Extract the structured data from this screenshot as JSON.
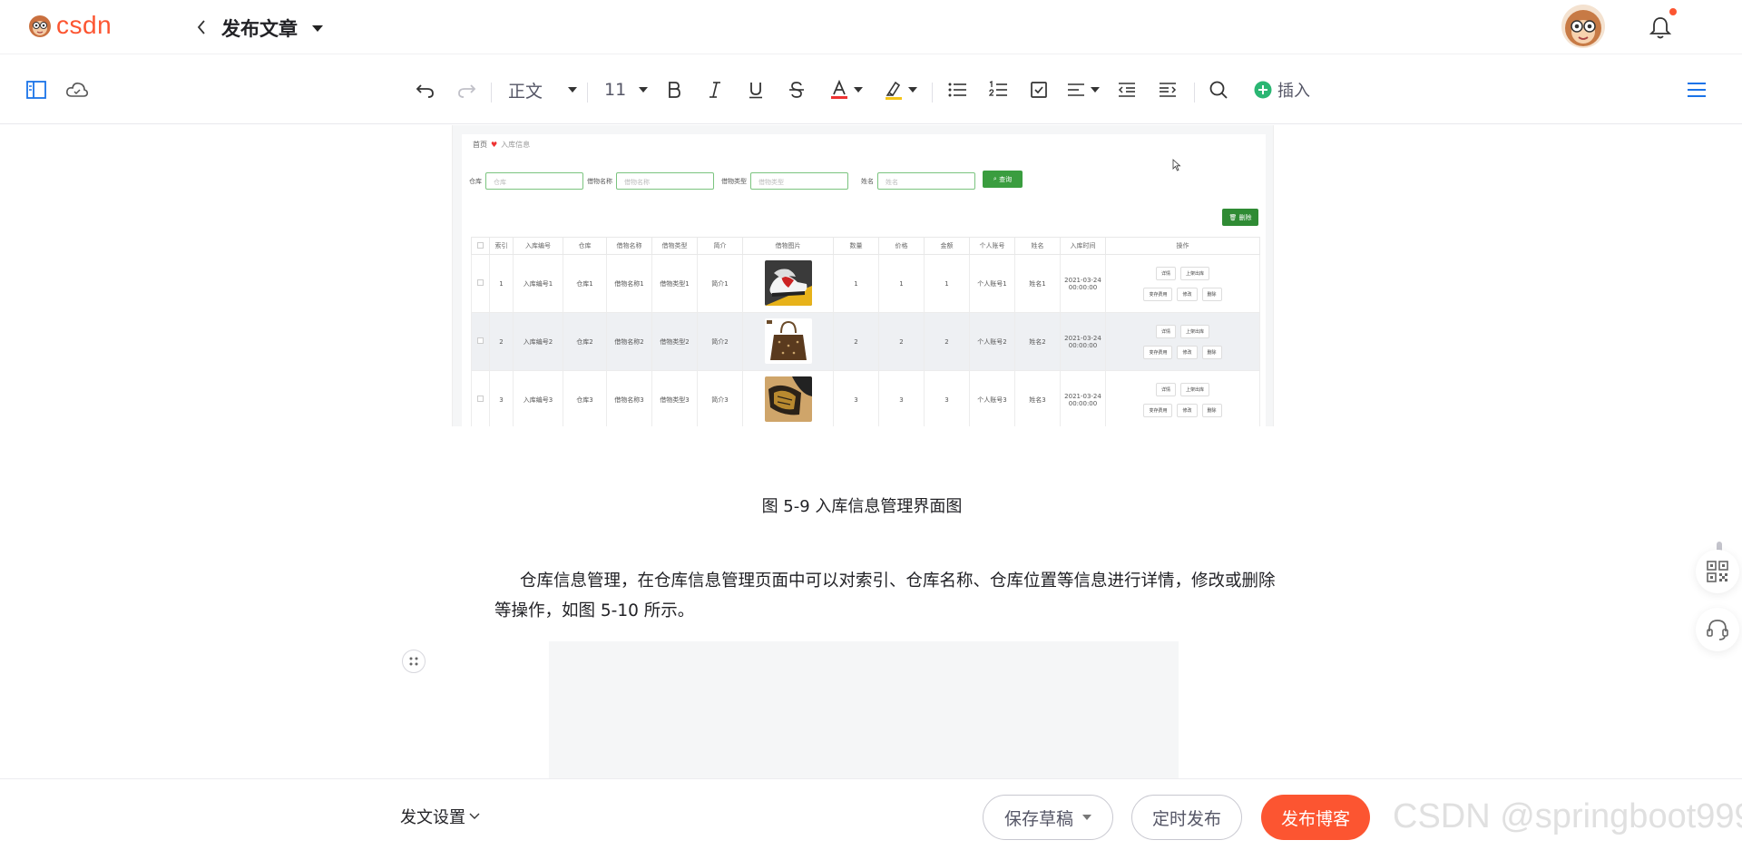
{
  "brand": {
    "wordmark": "csdn",
    "accent": "#fc5531"
  },
  "header": {
    "title": "发布文章"
  },
  "toolbar": {
    "paragraph_style": "正文",
    "font_size": "11",
    "insert_label": "插入"
  },
  "figure": {
    "breadcrumb_home": "首页",
    "breadcrumb_current": "入库信息",
    "filters": [
      {
        "label": "仓库",
        "placeholder": "仓库"
      },
      {
        "label": "借物名称",
        "placeholder": "借物名称"
      },
      {
        "label": "借物类型",
        "placeholder": "借物类型"
      },
      {
        "label": "姓名",
        "placeholder": "姓名"
      }
    ],
    "search_label": "查询",
    "delete_label": "删除",
    "columns": [
      "索引",
      "入库编号",
      "仓库",
      "借物名称",
      "借物类型",
      "简介",
      "借物图片",
      "数量",
      "价格",
      "金额",
      "个人账号",
      "姓名",
      "入库时间",
      "操作"
    ],
    "rows": [
      {
        "cells": [
          "1",
          "入库编号1",
          "仓库1",
          "借物名称1",
          "借物类型1",
          "简介1"
        ],
        "image": "sneakers",
        "nums": [
          "1",
          "1",
          "1"
        ],
        "account": "个人账号1",
        "name": "姓名1",
        "date": "2021-03-24",
        "time": "00:00:00"
      },
      {
        "cells": [
          "2",
          "入库编号2",
          "仓库2",
          "借物名称2",
          "借物类型2",
          "简介2"
        ],
        "image": "handbag",
        "nums": [
          "2",
          "2",
          "2"
        ],
        "account": "个人账号2",
        "name": "姓名2",
        "date": "2021-03-24",
        "time": "00:00:00"
      },
      {
        "cells": [
          "3",
          "入库编号3",
          "仓库3",
          "借物名称3",
          "借物类型3",
          "简介3"
        ],
        "image": "leather-goods",
        "nums": [
          "3",
          "3",
          "3"
        ],
        "account": "个人账号3",
        "name": "姓名3",
        "date": "2021-03-24",
        "time": "00:00:00"
      }
    ],
    "ops": {
      "detail": "详情",
      "upload": "上架出库",
      "changes": "变存费用",
      "edit": "修改",
      "delete": "删除"
    }
  },
  "content": {
    "caption": "图 5-9 入库信息管理界面图",
    "paragraph": "仓库信息管理，在仓库信息管理页面中可以对索引、仓库名称、仓库位置等信息进行详情，修改或删除等操作，如图 5-10 所示。"
  },
  "bottom": {
    "settings_label": "发文设置",
    "save_draft": "保存草稿",
    "schedule": "定时发布",
    "publish": "发布博客",
    "watermark": "CSDN @springboot999"
  }
}
